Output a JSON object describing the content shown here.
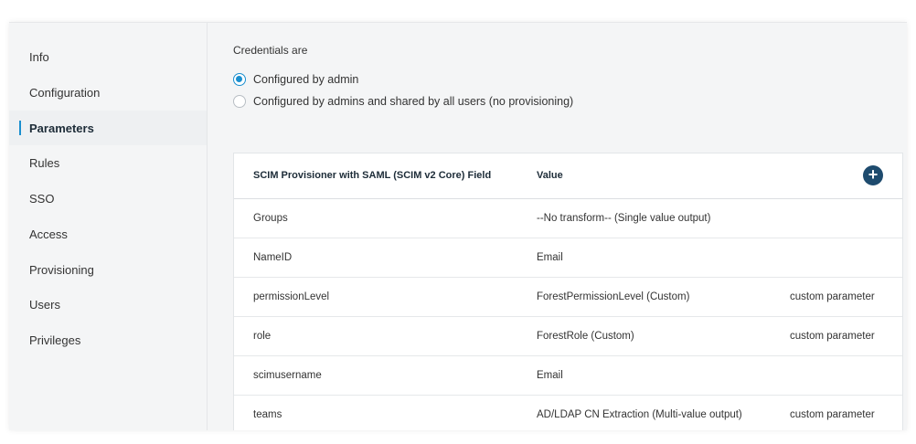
{
  "sidebar": {
    "items": [
      {
        "label": "Info"
      },
      {
        "label": "Configuration"
      },
      {
        "label": "Parameters",
        "active": true
      },
      {
        "label": "Rules"
      },
      {
        "label": "SSO"
      },
      {
        "label": "Access"
      },
      {
        "label": "Provisioning"
      },
      {
        "label": "Users"
      },
      {
        "label": "Privileges"
      }
    ]
  },
  "credentials": {
    "label": "Credentials are",
    "options": [
      {
        "label": "Configured by admin",
        "selected": true
      },
      {
        "label": "Configured by admins and shared by all users (no provisioning)",
        "selected": false
      }
    ]
  },
  "table": {
    "headers": [
      "SCIM Provisioner with SAML (SCIM v2 Core) Field",
      "Value"
    ],
    "add_icon": "plus-circle-icon",
    "rows": [
      {
        "field": "Groups",
        "value": "--No transform-- (Single value output)",
        "note": ""
      },
      {
        "field": "NameID",
        "value": "Email",
        "note": ""
      },
      {
        "field": "permissionLevel",
        "value": "ForestPermissionLevel (Custom)",
        "note": "custom parameter"
      },
      {
        "field": "role",
        "value": "ForestRole (Custom)",
        "note": "custom parameter"
      },
      {
        "field": "scimusername",
        "value": "Email",
        "note": ""
      },
      {
        "field": "teams",
        "value": "AD/LDAP CN Extraction (Multi-value output)",
        "note": "custom parameter"
      }
    ]
  },
  "colors": {
    "accent": "#1a8fcf",
    "add_button": "#1e4b6e"
  }
}
